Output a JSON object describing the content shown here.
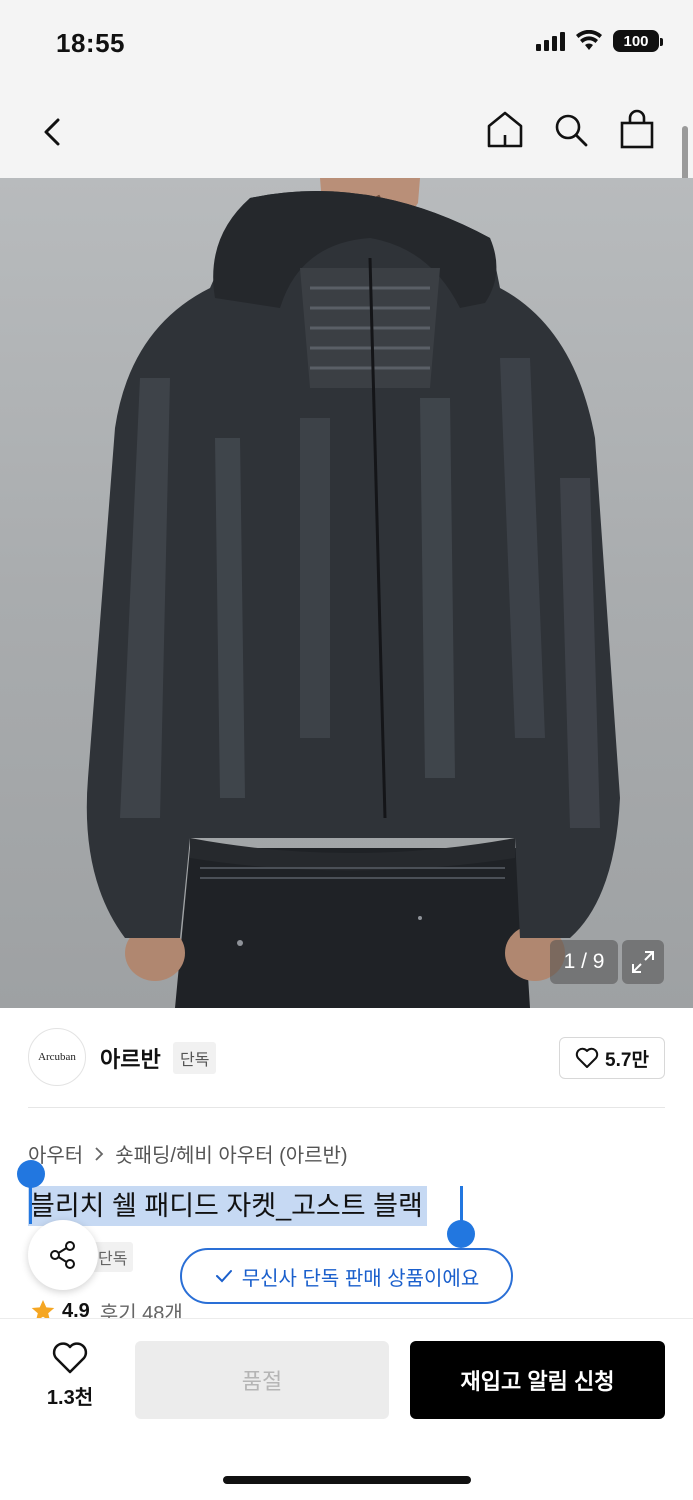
{
  "status_bar": {
    "time": "18:55",
    "battery": "100"
  },
  "nav": {
    "back_icon": "chevron-left-icon",
    "icons": [
      "home-icon",
      "search-icon",
      "shopping-bag-icon"
    ]
  },
  "gallery": {
    "counter": "1 / 9",
    "expand_icon": "expand-icon"
  },
  "brand": {
    "logo_text": "Arcuban",
    "name": "아르반",
    "badge": "단독",
    "likes": "5.7만"
  },
  "product": {
    "breadcrumb": [
      "아우터",
      "숏패딩/헤비 아우터 (아르반)"
    ],
    "title": "블리치 쉘 패디드 자켓_고스트 블랙",
    "exclusive_badge": "단독",
    "exclusive_toast": "무신사 단독 판매 상품이에요",
    "rating": "4.9",
    "reviews": "후기 48개"
  },
  "bottom_bar": {
    "wish_count": "1.3천",
    "soldout_label": "품절",
    "restock_label": "재입고 알림 신청"
  },
  "colors": {
    "accent_blue": "#2a6fd6",
    "selection": "#c6d9f3",
    "star": "#f5a623"
  }
}
